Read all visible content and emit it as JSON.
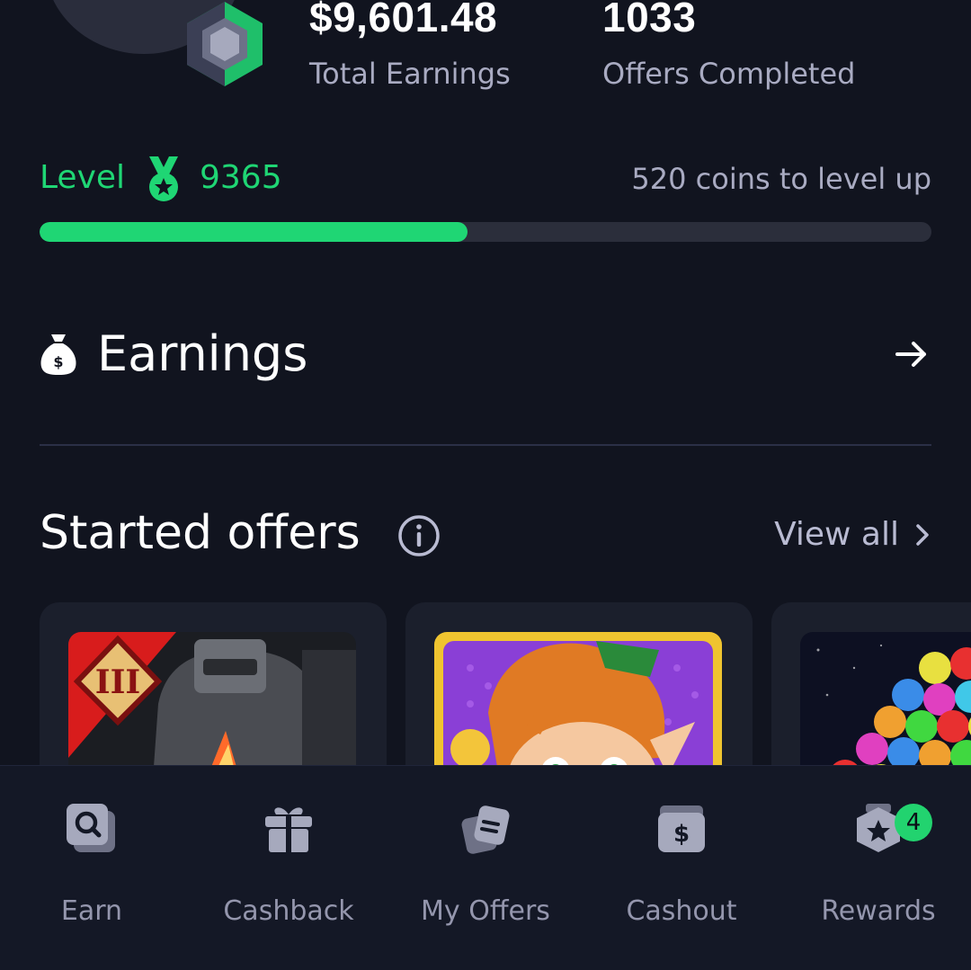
{
  "stats": {
    "total_earnings_value": "$9,601.48",
    "total_earnings_label": "Total Earnings",
    "offers_completed_value": "1033",
    "offers_completed_label": "Offers Completed"
  },
  "level": {
    "label": "Level",
    "number": "9365",
    "hint": "520 coins to level up",
    "progress": 0.48,
    "medal_icon": "medal-icon"
  },
  "earnings": {
    "title": "Earnings",
    "icon": "money-bag-icon",
    "arrow_icon": "arrow-right-icon"
  },
  "started_offers": {
    "title": "Started offers",
    "view_all": "View all",
    "offers": [
      {
        "icon": "game-thumbnail-robot"
      },
      {
        "icon": "game-thumbnail-leprechaun"
      },
      {
        "icon": "game-thumbnail-bubbles"
      }
    ]
  },
  "nav": {
    "items": [
      {
        "label": "Earn",
        "icon": "earn-search-icon"
      },
      {
        "label": "Cashback",
        "icon": "gift-icon"
      },
      {
        "label": "My Offers",
        "icon": "offers-cards-icon"
      },
      {
        "label": "Cashout",
        "icon": "dollar-wallet-icon"
      },
      {
        "label": "Rewards",
        "icon": "rewards-hexagon-icon",
        "badge": "4"
      }
    ]
  },
  "colors": {
    "background": "#11141f",
    "accent": "#1fd674",
    "muted_text": "#a9abc2",
    "badge": "#22d36f"
  }
}
